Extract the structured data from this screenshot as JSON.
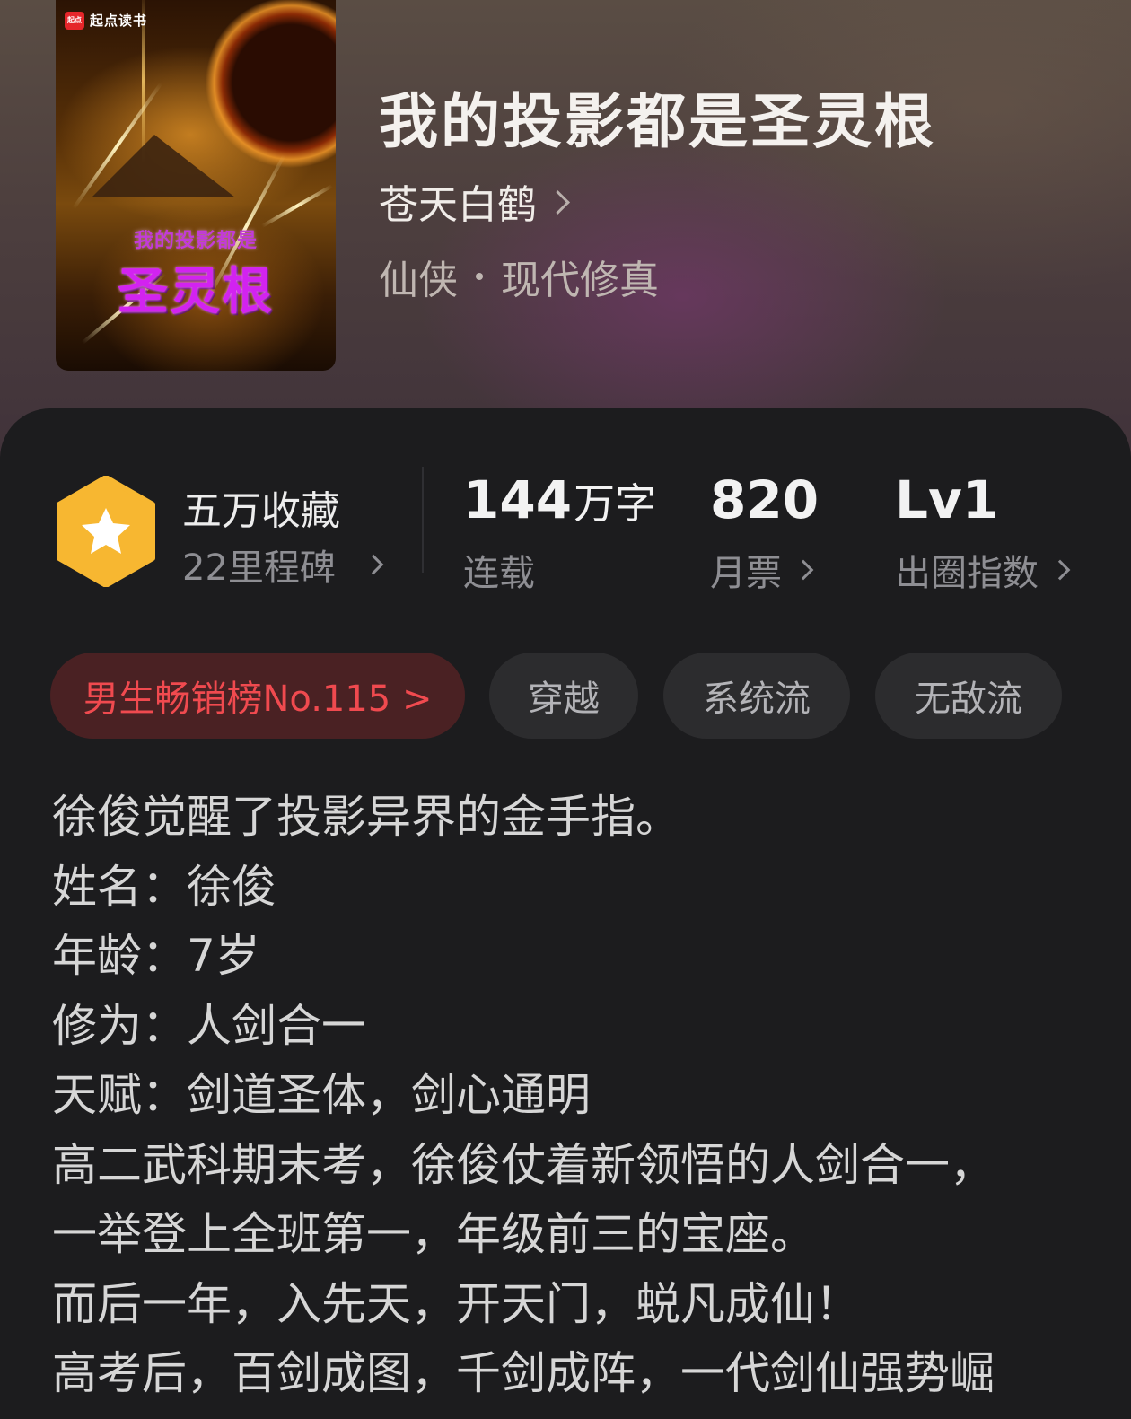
{
  "cover": {
    "brand": "起点读书",
    "brand_mark": "起点",
    "subtitle": "我的投影都是",
    "title": "圣灵根"
  },
  "book": {
    "title": "我的投影都是圣灵根",
    "author": "苍天白鹤",
    "genre_main": "仙侠",
    "genre_sub": "现代修真"
  },
  "stats": {
    "favorites": "五万收藏",
    "milestones": "22里程碑",
    "word_count": "144",
    "word_unit": "万字",
    "status": "连载",
    "monthly_votes": "820",
    "monthly_votes_label": "月票",
    "level": "Lv1",
    "level_label": "出圈指数"
  },
  "tags": {
    "rank": "男生畅销榜No.115 >",
    "items": [
      "穿越",
      "系统流",
      "无敌流"
    ]
  },
  "synopsis": [
    "徐俊觉醒了投影异界的金手指。",
    "姓名：徐俊",
    "年龄：7岁",
    "修为：人剑合一",
    "天赋：剑道圣体，剑心通明",
    "高二武科期末考，徐俊仗着新领悟的人剑合一，",
    "一举登上全班第一，年级前三的宝座。",
    "而后一年，入先天，开天门，蜕凡成仙！",
    "高考后，百剑成图，千剑成阵，一代剑仙强势崛"
  ],
  "colors": {
    "accent_red": "#f04a4f",
    "badge_gold": "#f7b731",
    "panel_bg": "#1c1c1e"
  }
}
